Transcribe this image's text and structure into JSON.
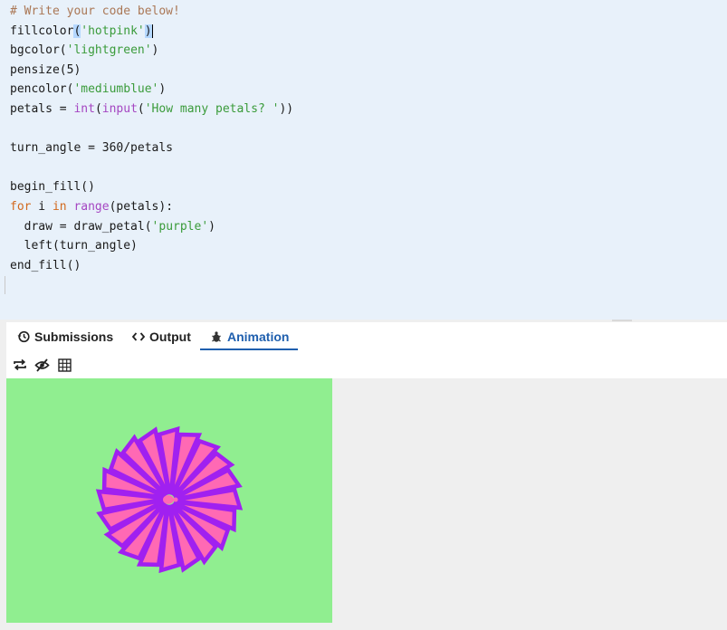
{
  "editor": {
    "lines": [
      [
        {
          "t": "# Write your code below!",
          "c": "cm-comment"
        }
      ],
      [
        {
          "t": "fillcolor"
        },
        {
          "t": "(",
          "c": "cm-bracket-hl"
        },
        {
          "t": "'hotpink'",
          "c": "cm-string"
        },
        {
          "t": ")",
          "c": "cm-bracket-hl"
        },
        {
          "t": "",
          "c": "cursor"
        }
      ],
      [
        {
          "t": "bgcolor("
        },
        {
          "t": "'lightgreen'",
          "c": "cm-string"
        },
        {
          "t": ")"
        }
      ],
      [
        {
          "t": "pensize(5)"
        }
      ],
      [
        {
          "t": "pencolor("
        },
        {
          "t": "'mediumblue'",
          "c": "cm-string"
        },
        {
          "t": ")"
        }
      ],
      [
        {
          "t": "petals = "
        },
        {
          "t": "int",
          "c": "cm-builtin"
        },
        {
          "t": "("
        },
        {
          "t": "input",
          "c": "cm-builtin"
        },
        {
          "t": "("
        },
        {
          "t": "'How many petals? '",
          "c": "cm-string"
        },
        {
          "t": "))"
        }
      ],
      [
        {
          "t": ""
        }
      ],
      [
        {
          "t": "turn_angle = 360/petals"
        }
      ],
      [
        {
          "t": ""
        }
      ],
      [
        {
          "t": "begin_fill()"
        }
      ],
      [
        {
          "t": "for",
          "c": "cm-keyword"
        },
        {
          "t": " i "
        },
        {
          "t": "in",
          "c": "cm-keyword"
        },
        {
          "t": " "
        },
        {
          "t": "range",
          "c": "cm-builtin"
        },
        {
          "t": "(petals):"
        }
      ],
      [
        {
          "t": "  draw = draw_petal("
        },
        {
          "t": "'purple'",
          "c": "cm-string"
        },
        {
          "t": ")"
        }
      ],
      [
        {
          "t": "  left(turn_angle)"
        }
      ],
      [
        {
          "t": "end_fill()"
        }
      ]
    ]
  },
  "tabs": {
    "submissions": "Submissions",
    "output": "Output",
    "animation": "Animation",
    "active": "animation"
  },
  "toolbar": {
    "icons": [
      "repeat-icon",
      "eye-slash-icon",
      "grid-icon"
    ]
  },
  "canvas": {
    "background": "#90ee90",
    "petal_fill": "#ff69b4",
    "petal_stroke": "#a020f0",
    "turtle_color": "#ff69b4",
    "petal_count": 20
  }
}
